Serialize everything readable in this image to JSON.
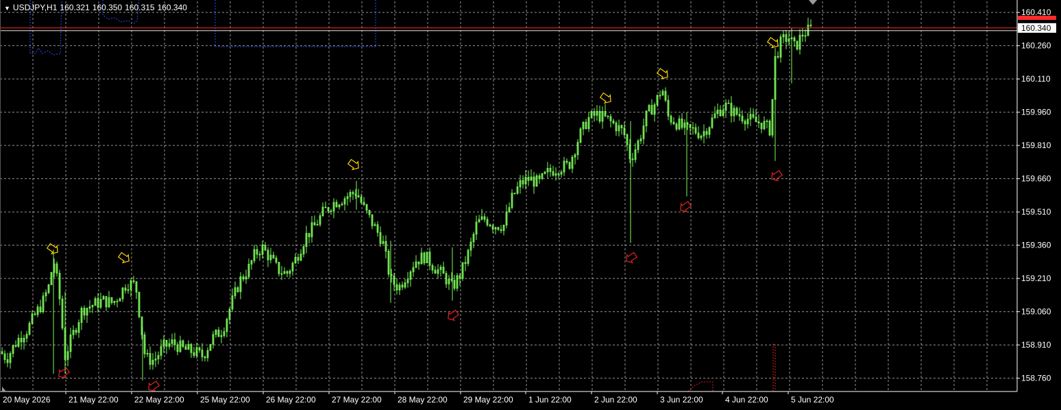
{
  "header": {
    "symbol": "USDJPY,H1",
    "open": "160.321",
    "high": "160.350",
    "low": "160.315",
    "close": "160.340"
  },
  "colors": {
    "background": "#000000",
    "grid": "#c8c8c8",
    "candle": "#7cfc5a",
    "bid_line": "#ff2a2a",
    "axis_text": "#ffffff",
    "buy_signal": "#ffd400",
    "sell_signal": "#e32222",
    "indicator": "#2a4dff"
  },
  "chart_data": {
    "type": "candlestick",
    "symbol": "USDJPY",
    "timeframe": "H1",
    "ylim": [
      158.7,
      160.46
    ],
    "y_ticks": [
      "160.410",
      "160.260",
      "160.110",
      "159.960",
      "159.810",
      "159.660",
      "159.510",
      "159.360",
      "159.210",
      "159.060",
      "158.910",
      "158.760"
    ],
    "x_ticks": [
      "20 May 2026",
      "21 May 22:00",
      "22 May 22:00",
      "25 May 22:00",
      "26 May 22:00",
      "27 May 22:00",
      "28 May 22:00",
      "29 May 22:00",
      "1 Jun 22:00",
      "2 Jun 22:00",
      "3 Jun 22:00",
      "4 Jun 22:00",
      "5 Jun 22:00"
    ],
    "current_price": "160.340",
    "price_points": [
      [
        0,
        158.88
      ],
      [
        10,
        158.85
      ],
      [
        25,
        158.93
      ],
      [
        40,
        158.98
      ],
      [
        52,
        159.05
      ],
      [
        62,
        159.1
      ],
      [
        72,
        159.18
      ],
      [
        78,
        159.3
      ],
      [
        86,
        159.15
      ],
      [
        95,
        158.86
      ],
      [
        108,
        158.97
      ],
      [
        120,
        159.07
      ],
      [
        135,
        159.09
      ],
      [
        150,
        159.11
      ],
      [
        165,
        159.1
      ],
      [
        175,
        159.14
      ],
      [
        185,
        159.19
      ],
      [
        198,
        159.18
      ],
      [
        212,
        158.85
      ],
      [
        225,
        158.84
      ],
      [
        238,
        158.9
      ],
      [
        252,
        158.92
      ],
      [
        268,
        158.89
      ],
      [
        282,
        158.88
      ],
      [
        296,
        158.86
      ],
      [
        310,
        158.94
      ],
      [
        325,
        158.98
      ],
      [
        338,
        159.1
      ],
      [
        350,
        159.2
      ],
      [
        362,
        159.25
      ],
      [
        372,
        159.32
      ],
      [
        382,
        159.35
      ],
      [
        395,
        159.3
      ],
      [
        405,
        159.25
      ],
      [
        418,
        159.23
      ],
      [
        432,
        159.3
      ],
      [
        446,
        159.4
      ],
      [
        460,
        159.45
      ],
      [
        472,
        159.51
      ],
      [
        486,
        159.55
      ],
      [
        500,
        159.57
      ],
      [
        512,
        159.59
      ],
      [
        520,
        159.6
      ],
      [
        532,
        159.52
      ],
      [
        545,
        159.45
      ],
      [
        558,
        159.38
      ],
      [
        570,
        159.2
      ],
      [
        582,
        159.17
      ],
      [
        594,
        159.23
      ],
      [
        606,
        159.29
      ],
      [
        620,
        159.31
      ],
      [
        634,
        159.26
      ],
      [
        648,
        159.22
      ],
      [
        660,
        159.17
      ],
      [
        672,
        159.23
      ],
      [
        684,
        159.33
      ],
      [
        696,
        159.46
      ],
      [
        708,
        159.48
      ],
      [
        720,
        159.45
      ],
      [
        735,
        159.45
      ],
      [
        748,
        159.58
      ],
      [
        760,
        159.64
      ],
      [
        772,
        159.66
      ],
      [
        786,
        159.64
      ],
      [
        800,
        159.69
      ],
      [
        815,
        159.71
      ],
      [
        830,
        159.72
      ],
      [
        845,
        159.85
      ],
      [
        858,
        159.93
      ],
      [
        870,
        159.95
      ],
      [
        885,
        159.93
      ],
      [
        898,
        159.9
      ],
      [
        910,
        159.87
      ],
      [
        920,
        159.75
      ],
      [
        932,
        159.83
      ],
      [
        944,
        159.95
      ],
      [
        956,
        160.0
      ],
      [
        966,
        160.07
      ],
      [
        975,
        159.94
      ],
      [
        988,
        159.91
      ],
      [
        1000,
        159.88
      ],
      [
        1012,
        159.88
      ],
      [
        1024,
        159.86
      ],
      [
        1036,
        159.91
      ],
      [
        1046,
        159.96
      ],
      [
        1058,
        159.99
      ],
      [
        1070,
        159.96
      ],
      [
        1084,
        159.94
      ],
      [
        1098,
        159.92
      ],
      [
        1112,
        159.91
      ],
      [
        1124,
        159.88
      ],
      [
        1131,
        160.2
      ],
      [
        1140,
        160.28
      ],
      [
        1150,
        160.3
      ],
      [
        1160,
        160.25
      ],
      [
        1170,
        160.31
      ],
      [
        1180,
        160.33
      ],
      [
        1186,
        160.34
      ]
    ],
    "spikes": [
      {
        "t": 78,
        "high": 159.34,
        "low": 158.78
      },
      {
        "t": 95,
        "high": 159.15,
        "low": 158.78
      },
      {
        "t": 208,
        "high": 158.99,
        "low": 158.75
      },
      {
        "t": 520,
        "high": 159.65,
        "low": 159.52
      },
      {
        "t": 570,
        "high": 159.38,
        "low": 159.1
      },
      {
        "t": 660,
        "high": 159.35,
        "low": 159.11
      },
      {
        "t": 920,
        "high": 159.92,
        "low": 159.37
      },
      {
        "t": 1002,
        "high": 159.96,
        "low": 159.58
      },
      {
        "t": 1131,
        "high": 160.25,
        "low": 159.74
      },
      {
        "t": 1155,
        "high": 160.34,
        "low": 160.09
      }
    ],
    "buy_signals": [
      {
        "t": 77,
        "price": 159.34
      },
      {
        "t": 181,
        "price": 159.3
      },
      {
        "t": 516,
        "price": 159.72
      },
      {
        "t": 884,
        "price": 160.02
      },
      {
        "t": 967,
        "price": 160.13
      },
      {
        "t": 1128,
        "price": 160.27
      }
    ],
    "sell_signals": [
      {
        "t": 93,
        "price": 158.78
      },
      {
        "t": 224,
        "price": 158.72
      },
      {
        "t": 661,
        "price": 159.04
      },
      {
        "t": 921,
        "price": 159.3
      },
      {
        "t": 1000,
        "price": 159.53
      },
      {
        "t": 1133,
        "price": 159.67
      }
    ]
  }
}
